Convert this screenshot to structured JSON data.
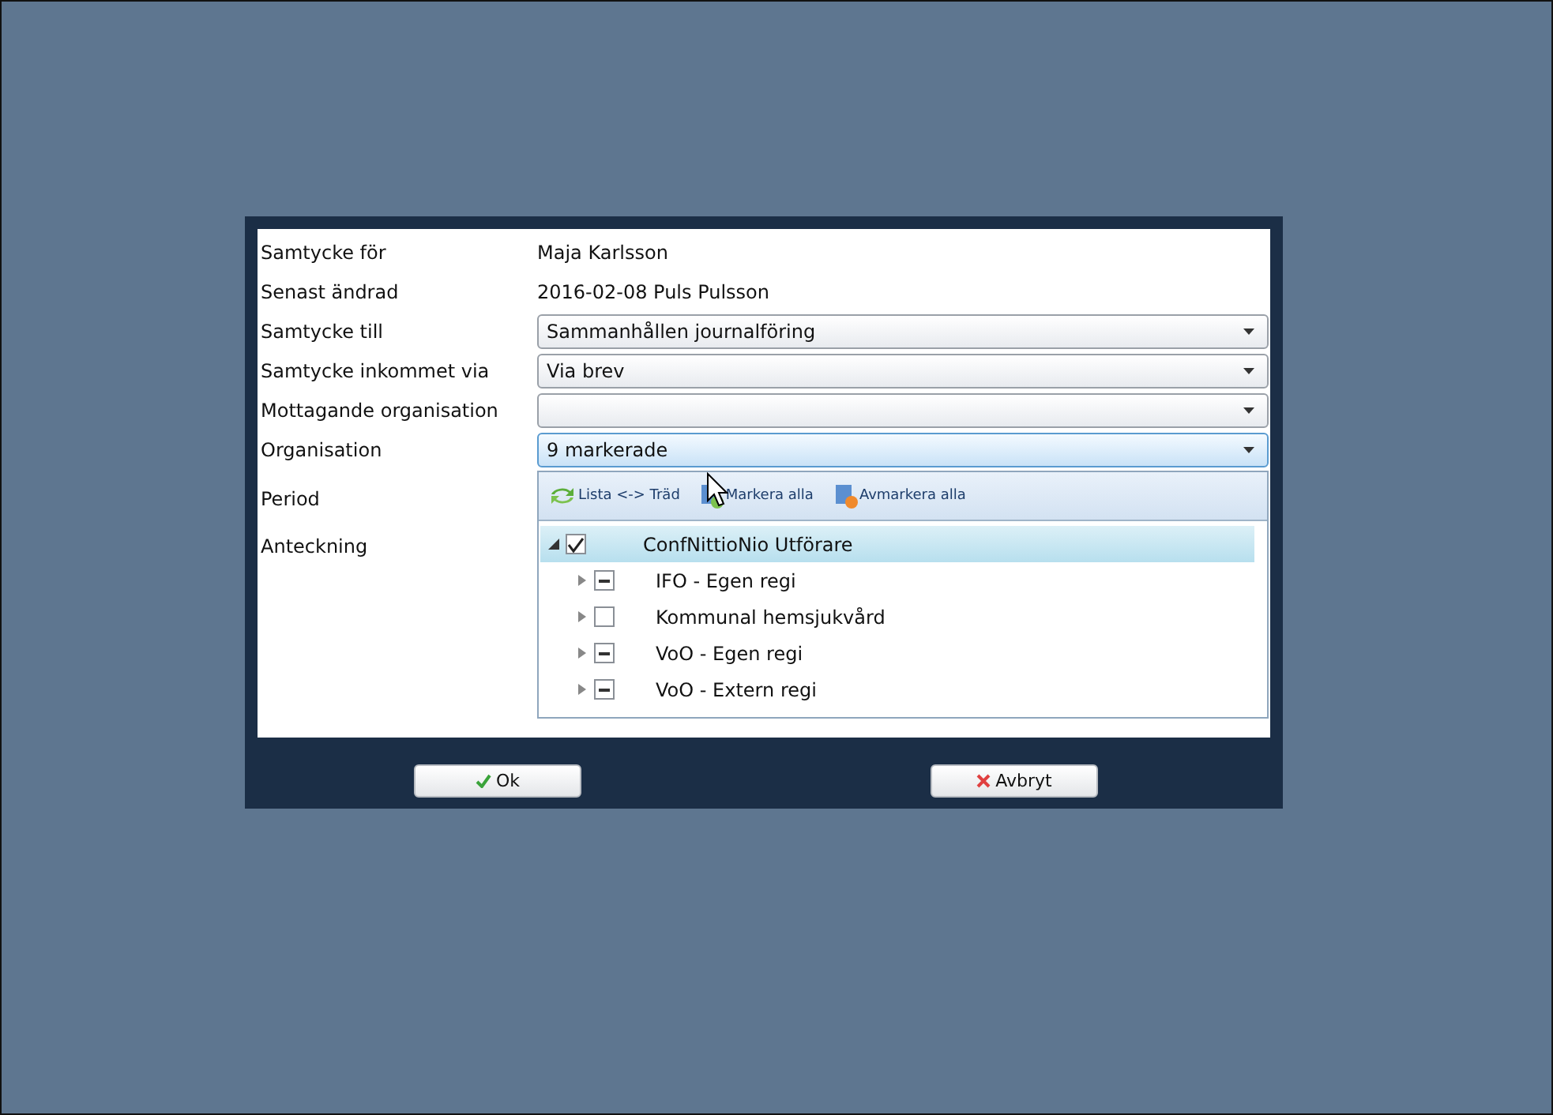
{
  "fields": [
    {
      "kind": "text",
      "label": "Samtycke för",
      "value": "Maja Karlsson"
    },
    {
      "kind": "text",
      "label": "Senast ändrad",
      "value": "2016-02-08 Puls Pulsson"
    },
    {
      "kind": "select",
      "label": "Samtycke till",
      "value": "Sammanhållen journalföring",
      "focused": false
    },
    {
      "kind": "select",
      "label": "Samtycke inkommet via",
      "value": "Via brev",
      "focused": false
    },
    {
      "kind": "select",
      "label": "Mottagande organisation",
      "focused": false
    },
    {
      "kind": "select",
      "label": "Organisation",
      "value": "9 markerade",
      "focused": true
    }
  ],
  "extra_labels": [
    "Period",
    "Anteckning"
  ],
  "dropdown": {
    "toolbar": [
      {
        "kind": "toggle",
        "label": "Lista <-> Träd"
      },
      {
        "kind": "select_all",
        "label": "Markera alla"
      },
      {
        "kind": "deselect_all",
        "label": "Avmarkera alla"
      }
    ],
    "tree": [
      {
        "label": "ConfNittioNio Utförare",
        "checked": true,
        "partial": false,
        "expanded": true,
        "selected": true,
        "children": [
          {
            "label": "IFO - Egen regi",
            "checked": false,
            "partial": true,
            "expanded": false,
            "selected": false
          },
          {
            "label": "Kommunal hemsjukvård",
            "checked": false,
            "partial": false,
            "expanded": false,
            "selected": false
          },
          {
            "label": "VoO - Egen regi",
            "checked": false,
            "partial": true,
            "expanded": false,
            "selected": false
          },
          {
            "label": "VoO - Extern regi",
            "checked": false,
            "partial": true,
            "expanded": false,
            "selected": false
          }
        ]
      }
    ]
  },
  "buttons": [
    {
      "kind": "ok",
      "label": "Ok"
    },
    {
      "kind": "cancel",
      "label": "Avbryt"
    }
  ]
}
